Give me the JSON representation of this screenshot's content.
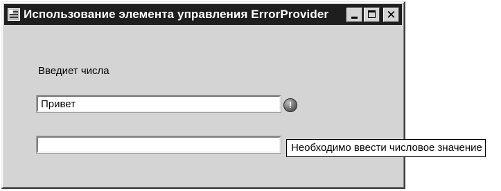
{
  "window": {
    "title": "Использование элемента управления ErrorProvider",
    "app_icon": "form-icon",
    "buttons": {
      "minimize_icon": "minimize-icon",
      "maximize_icon": "maximize-icon",
      "close_glyph": "✕"
    }
  },
  "form": {
    "prompt_label": "Введиет числа",
    "input1_value": "Привет",
    "input2_value": "",
    "error_icon": "error-exclamation-icon",
    "error_icon_glyph": "!"
  },
  "tooltip": {
    "text": "Необходимо ввести числовое значение"
  }
}
